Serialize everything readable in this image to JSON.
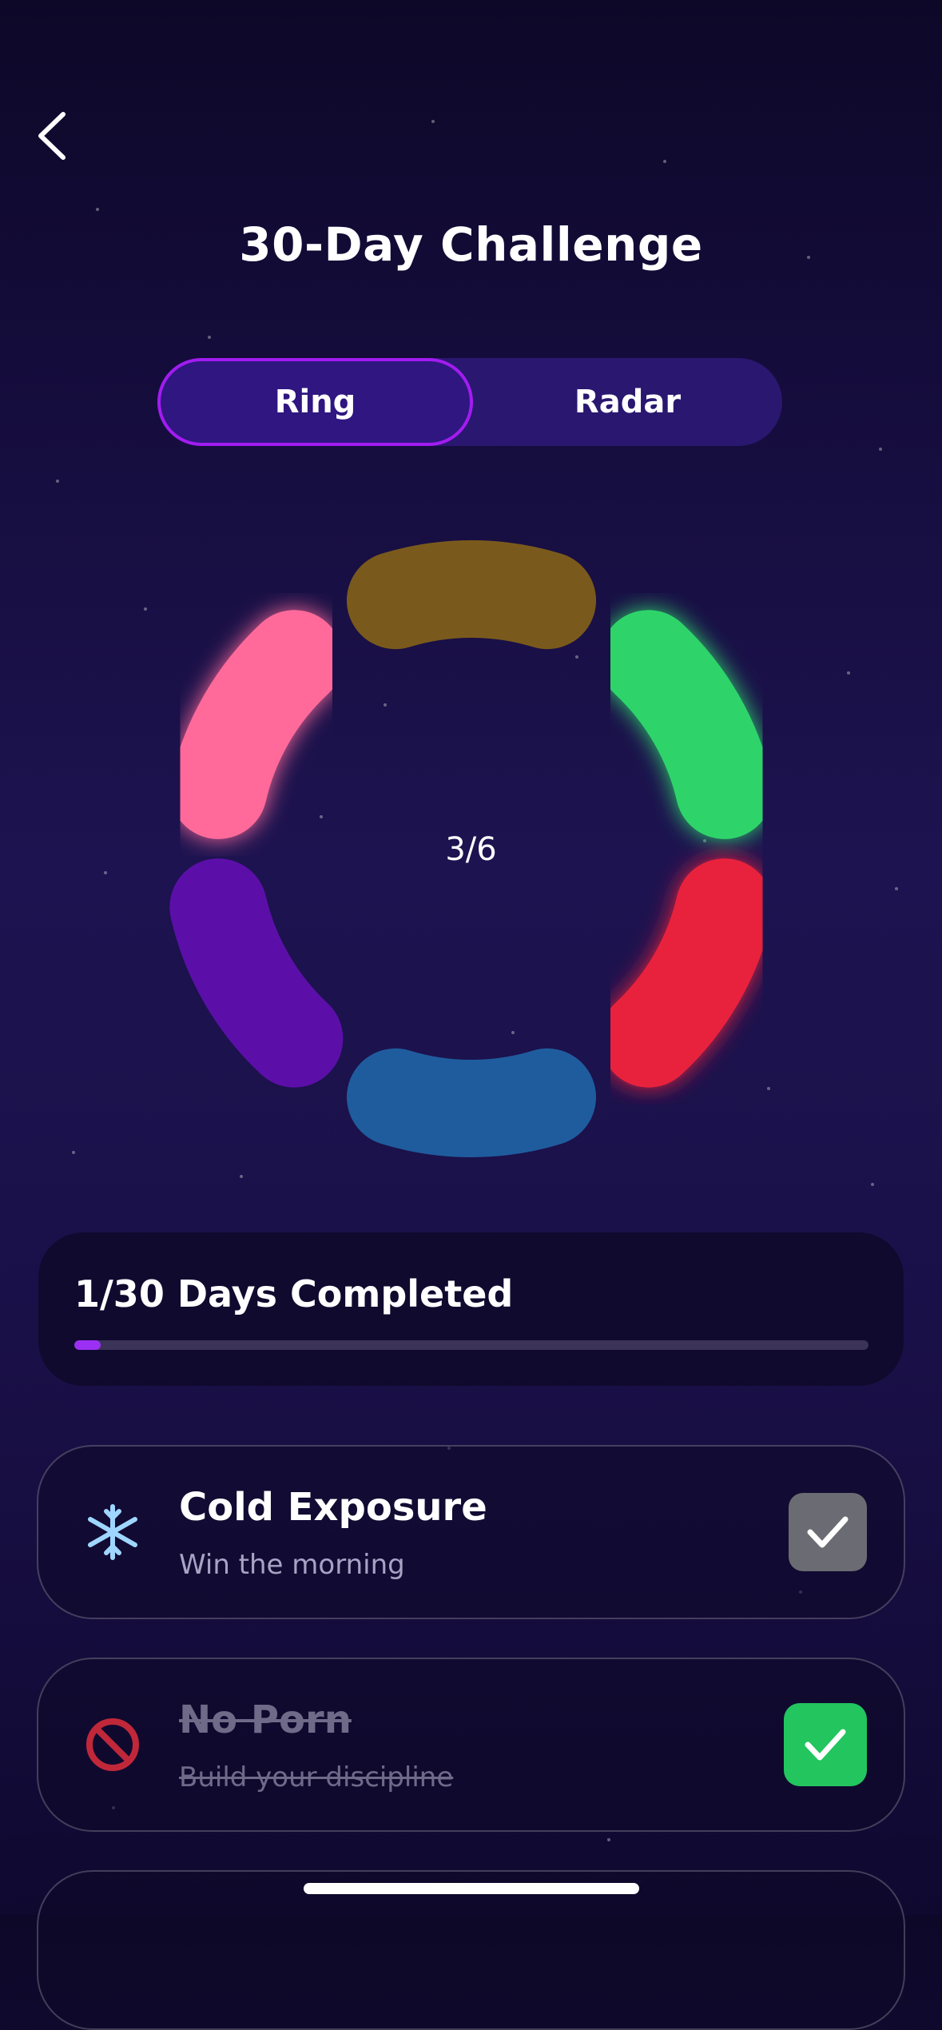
{
  "header": {
    "title": "30-Day Challenge"
  },
  "view_toggle": {
    "options": [
      "Ring",
      "Radar"
    ],
    "selected": "Ring"
  },
  "ring": {
    "center_label": "3/6",
    "segments": [
      {
        "name": "gold",
        "color": "#7a5a1c",
        "active": false
      },
      {
        "name": "green",
        "color": "#2ed46a",
        "active": true
      },
      {
        "name": "red",
        "color": "#e8203e",
        "active": true
      },
      {
        "name": "blue",
        "color": "#1f5c9e",
        "active": false
      },
      {
        "name": "purple",
        "color": "#5c0fa8",
        "active": false
      },
      {
        "name": "pink",
        "color": "#ff6b9a",
        "active": true
      }
    ]
  },
  "progress": {
    "label": "1/30 Days Completed",
    "completed": 1,
    "total": 30
  },
  "habits": [
    {
      "name": "Cold Exposure",
      "subtitle": "Win the morning",
      "icon": "snowflake-icon",
      "done": false
    },
    {
      "name": "No Porn",
      "subtitle": "Build your discipline",
      "icon": "prohibited-icon",
      "done": true
    }
  ],
  "colors": {
    "accent": "#a21cf0",
    "check_done": "#22c55e",
    "check_pending": "#6b6b73"
  }
}
